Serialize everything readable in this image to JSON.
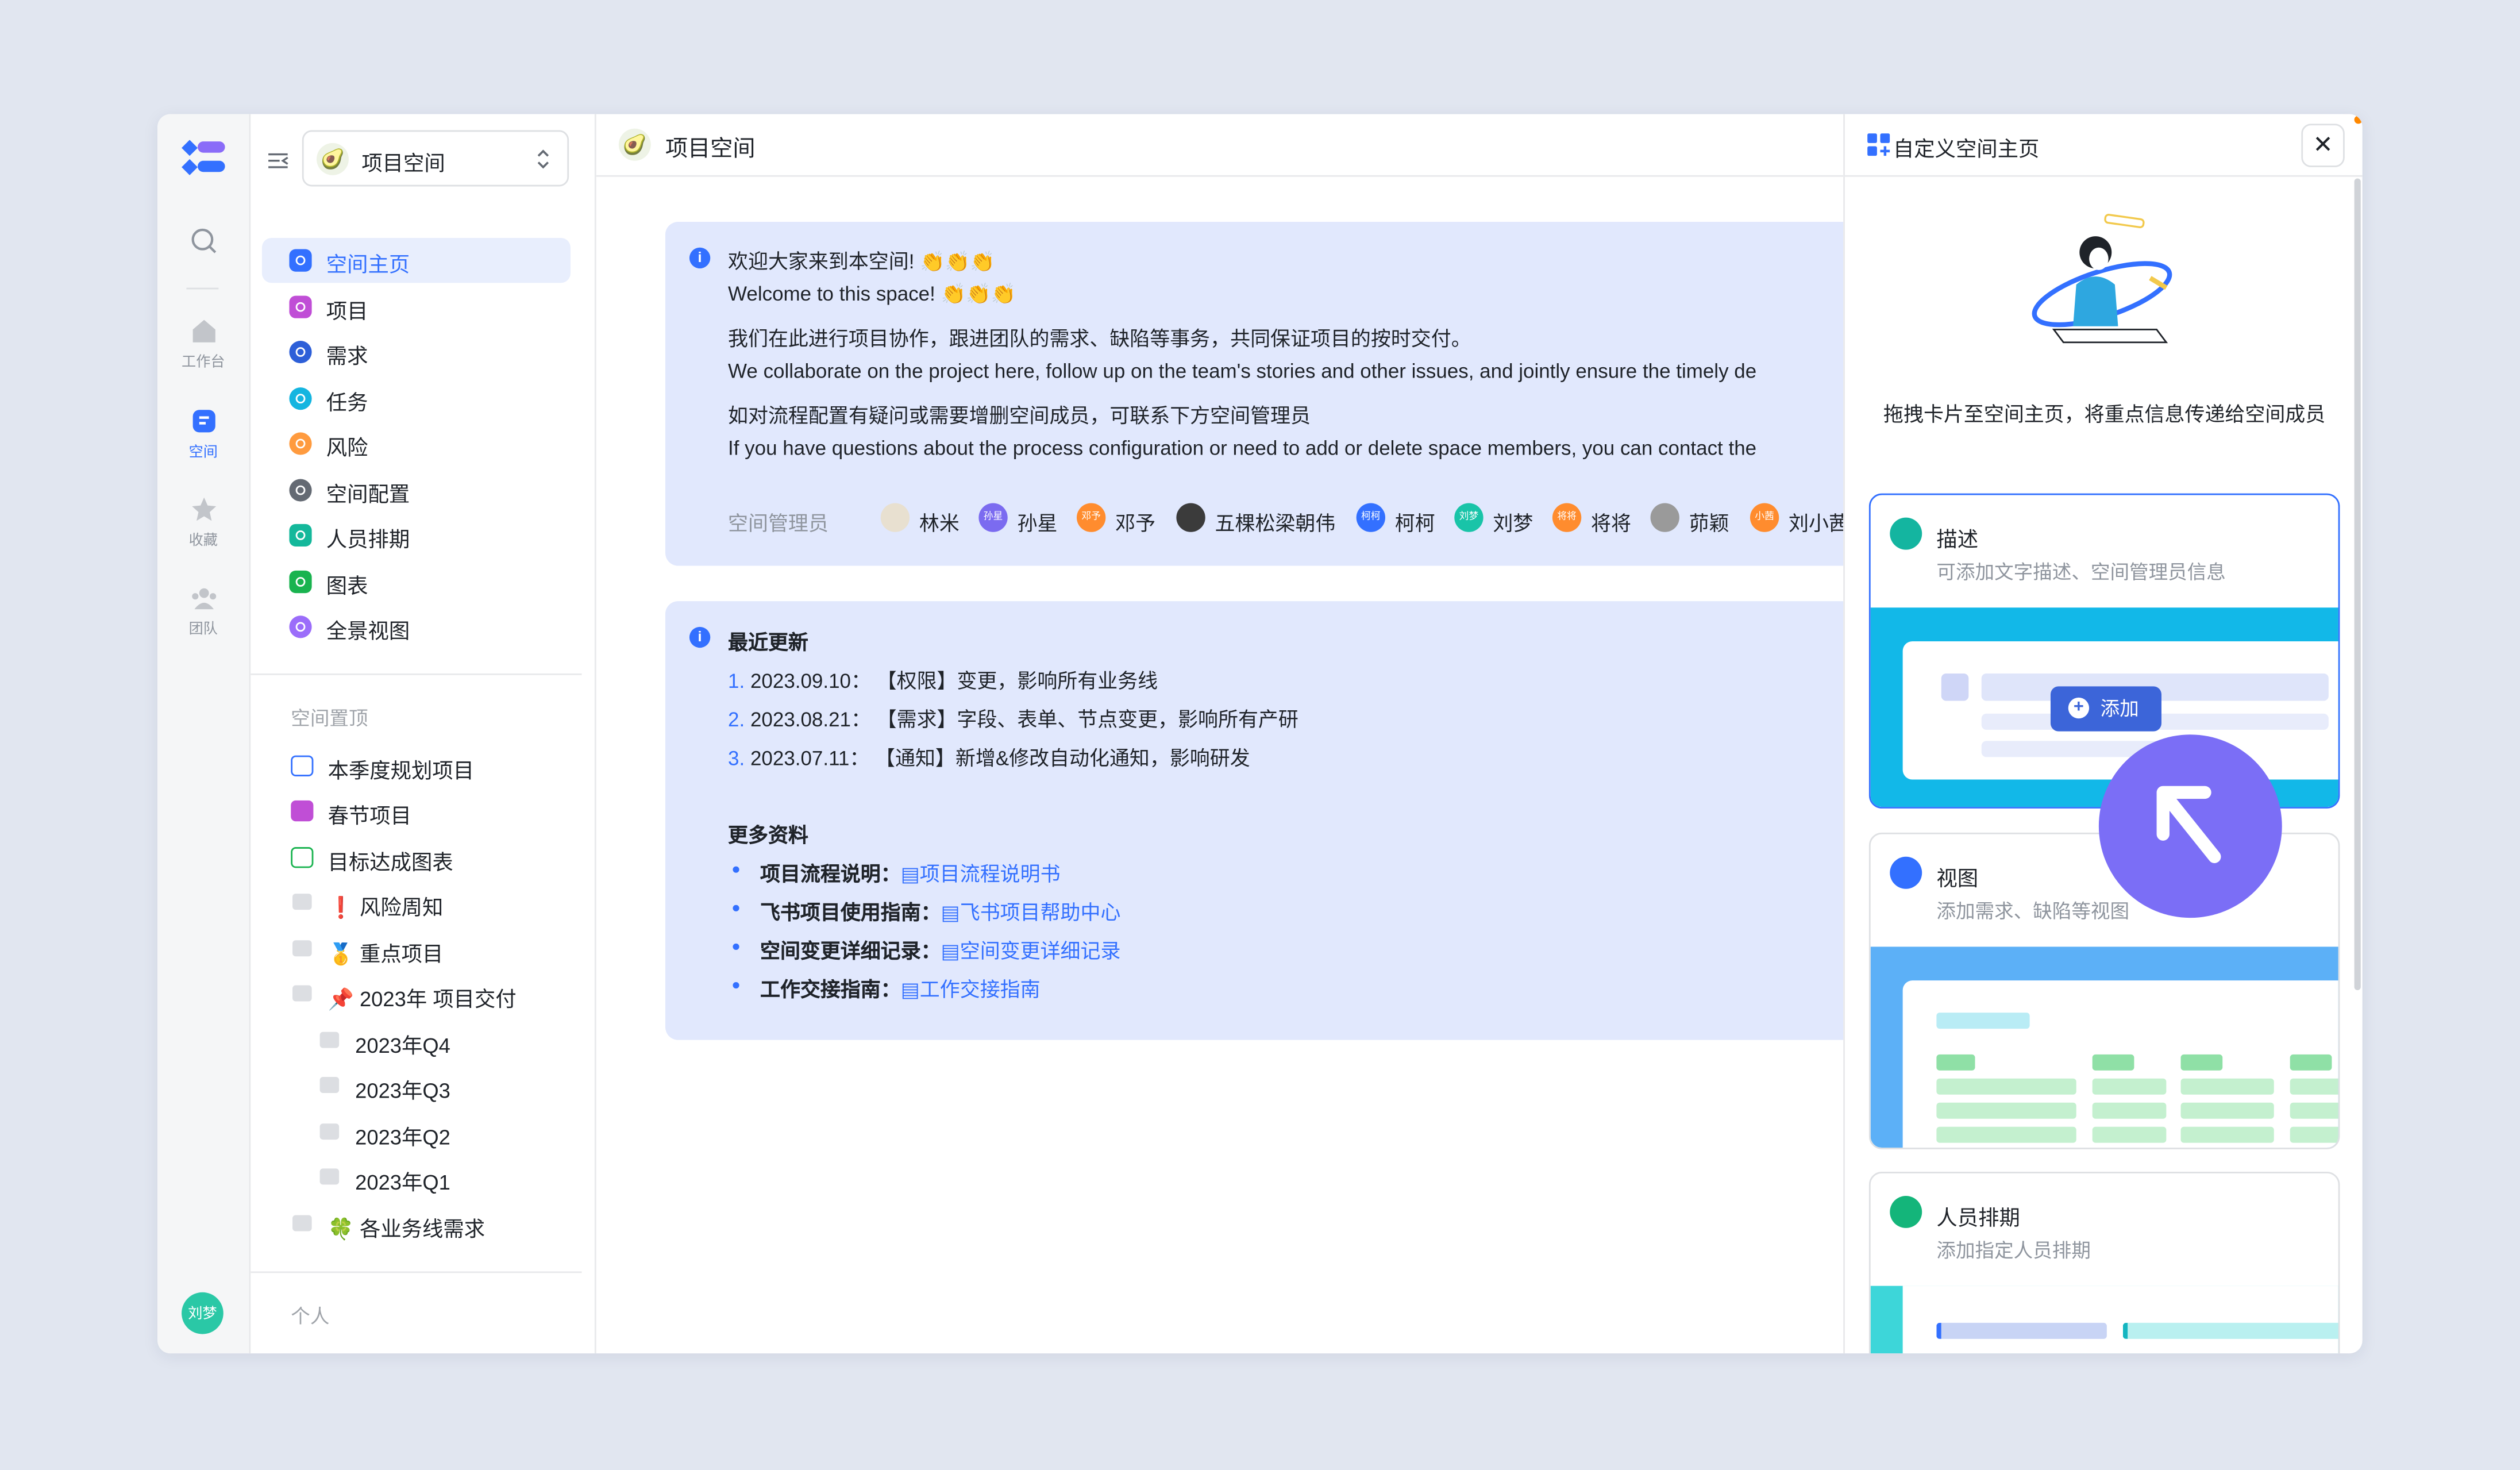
{
  "rail": {
    "items": [
      {
        "label": "",
        "icon": "search-icon"
      },
      {
        "label": "工作台",
        "icon": "home-icon"
      },
      {
        "label": "空间",
        "icon": "space-icon"
      },
      {
        "label": "收藏",
        "icon": "star-icon"
      },
      {
        "label": "团队",
        "icon": "team-icon"
      }
    ],
    "avatar": "刘梦"
  },
  "sidebar": {
    "space_name": "项目空间",
    "nav": [
      {
        "label": "空间主页",
        "color": "#3370ff"
      },
      {
        "label": "项目",
        "color": "#c04ed6"
      },
      {
        "label": "需求",
        "color": "#2d5fd8"
      },
      {
        "label": "任务",
        "color": "#14b5e0"
      },
      {
        "label": "风险",
        "color": "#ff9b3f"
      },
      {
        "label": "空间配置",
        "color": "#646a73"
      },
      {
        "label": "人员排期",
        "color": "#14b89b"
      },
      {
        "label": "图表",
        "color": "#19b34f"
      },
      {
        "label": "全景视图",
        "color": "#9b6dfa"
      }
    ],
    "pinned_title": "空间置顶",
    "pinned": [
      {
        "label": "本季度规划项目"
      },
      {
        "label": "春节项目"
      },
      {
        "label": "目标达成图表"
      },
      {
        "label": "❗ 风险周知"
      },
      {
        "label": "🥇 重点项目"
      },
      {
        "label": "📌 2023年 项目交付"
      },
      {
        "label": "2023年Q4"
      },
      {
        "label": "2023年Q3"
      },
      {
        "label": "2023年Q2"
      },
      {
        "label": "2023年Q1"
      },
      {
        "label": "🍀 各业务线需求"
      }
    ],
    "personal_title": "个人"
  },
  "main": {
    "title": "项目空间",
    "welcome": {
      "lines": [
        "欢迎大家来到本空间! 👏👏👏",
        "Welcome to this space! 👏👏👏",
        "我们在此进行项目协作，跟进团队的需求、缺陷等事务，共同保证项目的按时交付。",
        "We collaborate on the project here, follow up on the team's stories and other issues, and jointly ensure the timely de",
        "如对流程配置有疑问或需要增删空间成员，可联系下方空间管理员",
        "If you have questions about the process configuration or need to add or delete space members, you can contact the"
      ],
      "admins_label": "空间管理员",
      "admins": [
        {
          "name": "林米",
          "badge": "",
          "color": "#e8e0d0"
        },
        {
          "name": "孙星",
          "badge": "孙星",
          "color": "#7b6bf0"
        },
        {
          "name": "邓予",
          "badge": "邓予",
          "color": "#ff8c2e"
        },
        {
          "name": "五棵松梁朝伟",
          "badge": "",
          "color": "#3b3b3b"
        },
        {
          "name": "柯柯",
          "badge": "柯柯",
          "color": "#3370ff"
        },
        {
          "name": "刘梦",
          "badge": "刘梦",
          "color": "#19c4a8"
        },
        {
          "name": "将将",
          "badge": "将将",
          "color": "#ff8c2e"
        },
        {
          "name": "茆颖",
          "badge": "",
          "color": "#9a9a9a"
        },
        {
          "name": "刘小茜",
          "badge": "小茜",
          "color": "#ff8c2e"
        }
      ]
    },
    "updates": {
      "title": "最近更新",
      "items": [
        {
          "num": "1.",
          "text": "2023.09.10： 【权限】变更，影响所有业务线"
        },
        {
          "num": "2.",
          "text": "2023.08.21： 【需求】字段、表单、节点变更，影响所有产研"
        },
        {
          "num": "3.",
          "text": "2023.07.11： 【通知】新增&修改自动化通知，影响研发"
        }
      ],
      "more_title": "更多资料",
      "links": [
        {
          "label": "项目流程说明：",
          "link": "项目流程说明书"
        },
        {
          "label": "飞书项目使用指南：",
          "link": "飞书项目帮助中心"
        },
        {
          "label": "空间变更详细记录：",
          "link": "空间变更详细记录"
        },
        {
          "label": "工作交接指南：",
          "link": "工作交接指南"
        }
      ]
    }
  },
  "panel": {
    "title": "自定义空间主页",
    "description": "拖拽卡片至空间主页，将重点信息传递给空间成员",
    "cards": [
      {
        "title": "描述",
        "subtitle": "可添加文字描述、空间管理员信息",
        "color": "#14b5a0"
      },
      {
        "title": "视图",
        "subtitle": "添加需求、缺陷等视图",
        "color": "#3370ff"
      },
      {
        "title": "人员排期",
        "subtitle": "添加指定人员排期",
        "color": "#14b57a"
      }
    ],
    "add_button": "添加"
  }
}
